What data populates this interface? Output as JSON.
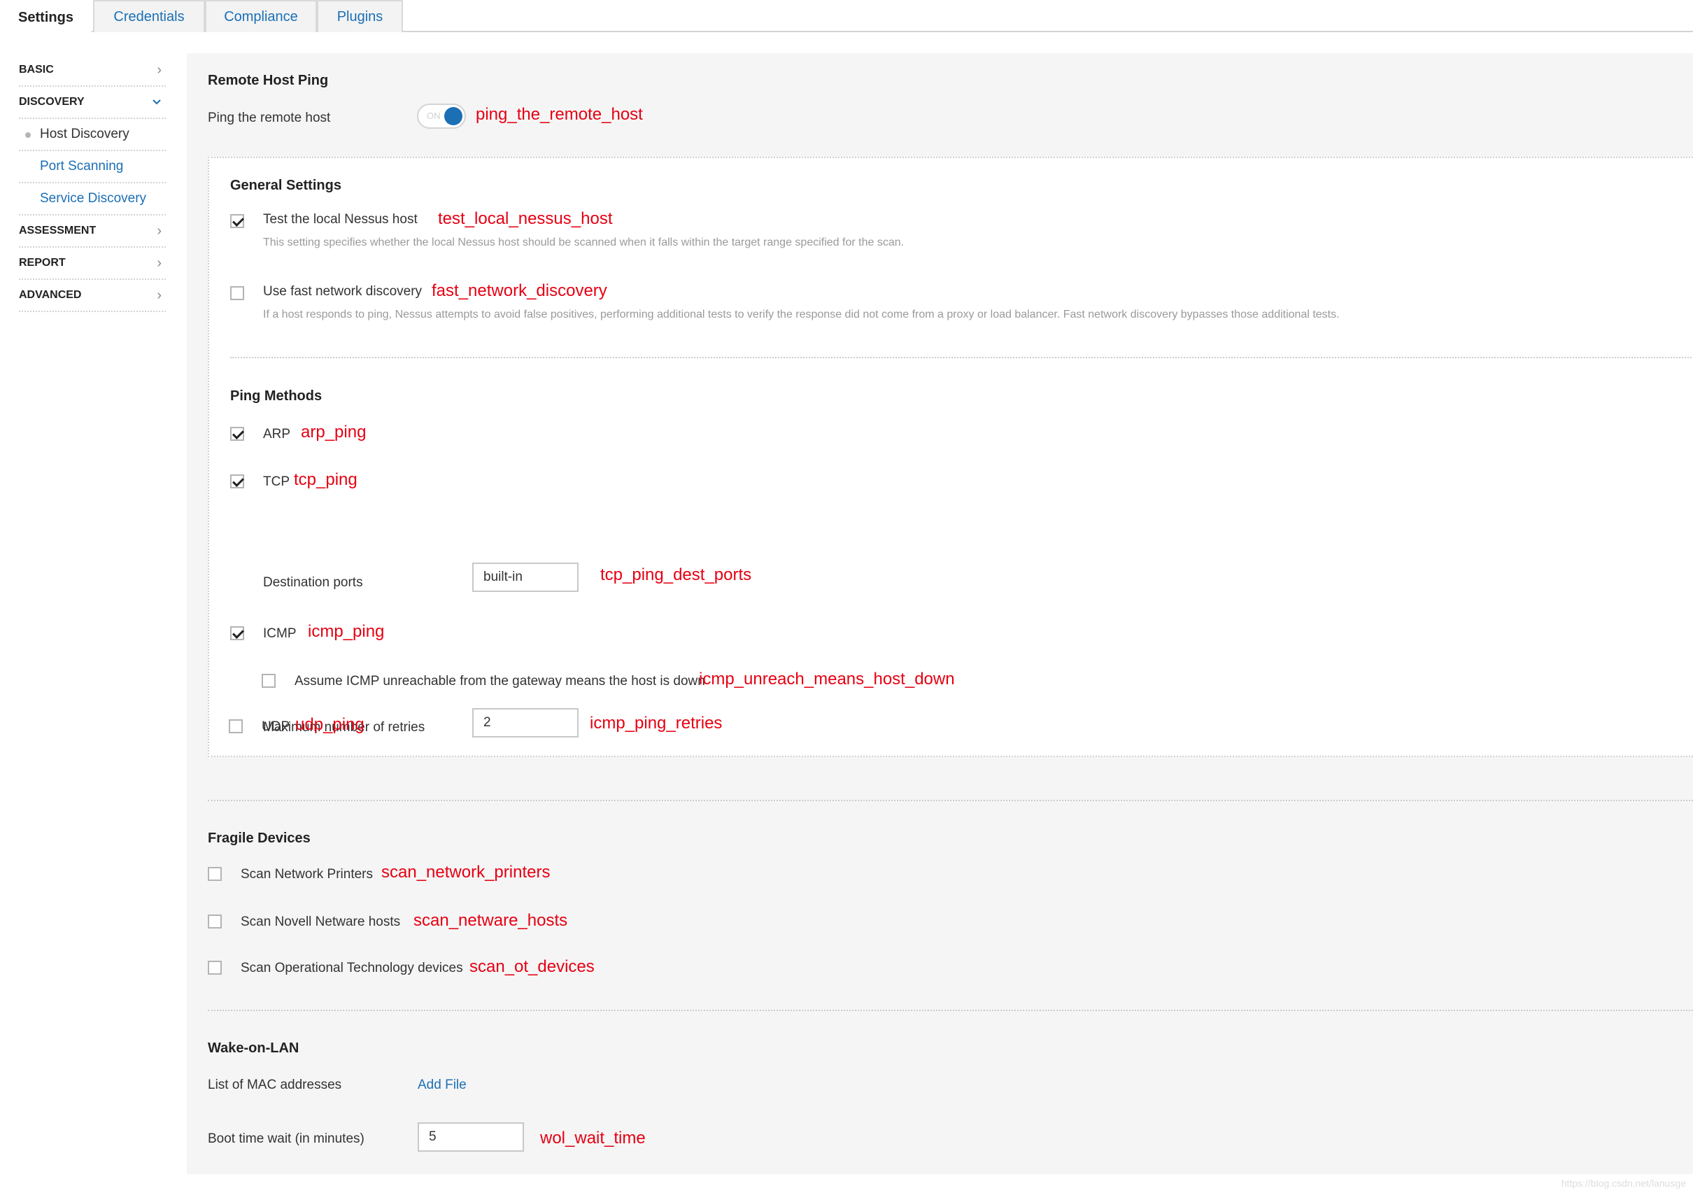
{
  "tabs": [
    {
      "label": "Settings",
      "active": true
    },
    {
      "label": "Credentials"
    },
    {
      "label": "Compliance"
    },
    {
      "label": "Plugins"
    }
  ],
  "sidebar": {
    "basic": "BASIC",
    "discovery": "DISCOVERY",
    "discovery_items": [
      "Host Discovery",
      "Port Scanning",
      "Service Discovery"
    ],
    "assessment": "ASSESSMENT",
    "report": "REPORT",
    "advanced": "ADVANCED"
  },
  "remote_host_ping": {
    "title": "Remote Host Ping",
    "ping_label": "Ping the remote host",
    "toggle_text": "ON",
    "toggle_on": true,
    "annotation": "ping_the_remote_host"
  },
  "general_settings": {
    "title": "General Settings",
    "test_local": {
      "label": "Test the local Nessus host",
      "checked": true,
      "annotation": "test_local_nessus_host",
      "description": "This setting specifies whether the local Nessus host should be scanned when it falls within the target range specified for the scan."
    },
    "fast_discovery": {
      "label": "Use fast network discovery",
      "checked": false,
      "annotation": "fast_network_discovery",
      "description": "If a host responds to ping, Nessus attempts to avoid false positives, performing additional tests to verify the response did not come from a proxy or load balancer. Fast network discovery bypasses those additional tests."
    }
  },
  "ping_methods": {
    "title": "Ping Methods",
    "arp": {
      "label": "ARP",
      "checked": true,
      "annotation": "arp_ping"
    },
    "tcp": {
      "label": "TCP",
      "checked": true,
      "annotation": "tcp_ping"
    },
    "dest_ports": {
      "label": "Destination ports",
      "value": "built-in",
      "annotation": "tcp_ping_dest_ports"
    },
    "icmp": {
      "label": "ICMP",
      "checked": true,
      "annotation": "icmp_ping"
    },
    "icmp_unreach": {
      "label": "Assume ICMP unreachable from the gateway means the host is down",
      "checked": false,
      "annotation": "icmp_unreach_means_host_down"
    },
    "max_retries": {
      "label": "Maximum number of retries",
      "value": "2",
      "annotation": "icmp_ping_retries"
    },
    "udp": {
      "label": "UDP",
      "checked": false,
      "annotation": "udp_ping"
    }
  },
  "fragile_devices": {
    "title": "Fragile Devices",
    "printers": {
      "label": "Scan Network Printers",
      "checked": false,
      "annotation": "scan_network_printers"
    },
    "netware": {
      "label": "Scan Novell Netware hosts",
      "checked": false,
      "annotation": "scan_netware_hosts"
    },
    "ot": {
      "label": "Scan Operational Technology devices",
      "checked": false,
      "annotation": "scan_ot_devices"
    }
  },
  "wake_on_lan": {
    "title": "Wake-on-LAN",
    "mac_label": "List of MAC addresses",
    "add_file": "Add File",
    "boot_label": "Boot time wait (in minutes)",
    "boot_value": "5",
    "annotation": "wol_wait_time"
  },
  "watermark": "https://blog.csdn.net/lanusge"
}
